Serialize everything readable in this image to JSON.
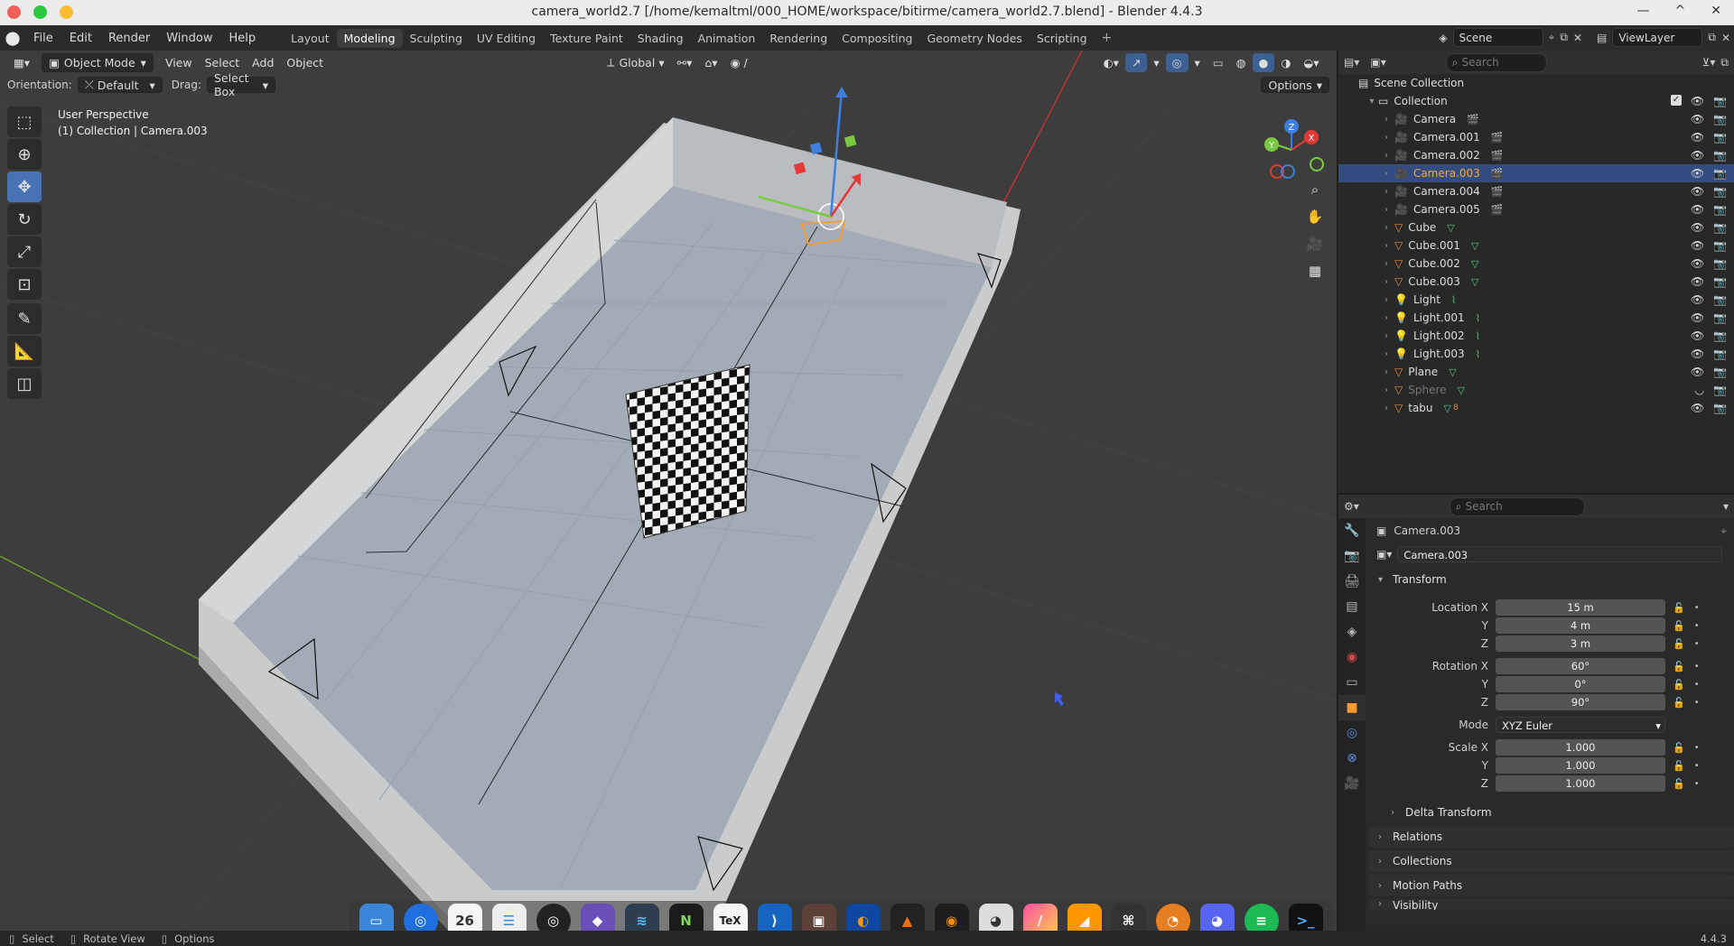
{
  "window": {
    "title": "camera_world2.7 [/home/kemaltml/000_HOME/workspace/bitirme/camera_world2.7.blend] - Blender 4.4.3",
    "buttons": [
      "—",
      "^",
      "✕"
    ]
  },
  "menubar": {
    "menus": [
      "File",
      "Edit",
      "Render",
      "Window",
      "Help"
    ],
    "workspaces": [
      "Layout",
      "Modeling",
      "Sculpting",
      "UV Editing",
      "Texture Paint",
      "Shading",
      "Animation",
      "Rendering",
      "Compositing",
      "Geometry Nodes",
      "Scripting"
    ],
    "active_workspace": "Modeling",
    "scene": "Scene",
    "view_layer": "ViewLayer"
  },
  "viewport": {
    "mode": "Object Mode",
    "menus": [
      "View",
      "Select",
      "Add",
      "Object"
    ],
    "transform_orientation": "Global",
    "orientation_label": "Orientation:",
    "orientation_value": "Default",
    "drag_label": "Drag:",
    "drag_value": "Select Box",
    "options": "Options",
    "perspective": "User Perspective",
    "context": "(1) Collection | Camera.003",
    "gizmo_labels": [
      "X",
      "Y",
      "Z"
    ]
  },
  "outliner": {
    "search_placeholder": "Search",
    "root": "Scene Collection",
    "collection": "Collection",
    "items": [
      {
        "name": "Camera",
        "type": "camera",
        "selected": false,
        "dim": false
      },
      {
        "name": "Camera.001",
        "type": "camera",
        "selected": false,
        "dim": false
      },
      {
        "name": "Camera.002",
        "type": "camera",
        "selected": false,
        "dim": false
      },
      {
        "name": "Camera.003",
        "type": "camera",
        "selected": true,
        "dim": false
      },
      {
        "name": "Camera.004",
        "type": "camera",
        "selected": false,
        "dim": false
      },
      {
        "name": "Camera.005",
        "type": "camera",
        "selected": false,
        "dim": false
      },
      {
        "name": "Cube",
        "type": "mesh",
        "selected": false,
        "dim": false
      },
      {
        "name": "Cube.001",
        "type": "mesh",
        "selected": false,
        "dim": false
      },
      {
        "name": "Cube.002",
        "type": "mesh",
        "selected": false,
        "dim": false
      },
      {
        "name": "Cube.003",
        "type": "mesh",
        "selected": false,
        "dim": false
      },
      {
        "name": "Light",
        "type": "light",
        "selected": false,
        "dim": false
      },
      {
        "name": "Light.001",
        "type": "light",
        "selected": false,
        "dim": false
      },
      {
        "name": "Light.002",
        "type": "light",
        "selected": false,
        "dim": false
      },
      {
        "name": "Light.003",
        "type": "light",
        "selected": false,
        "dim": false
      },
      {
        "name": "Plane",
        "type": "mesh",
        "selected": false,
        "dim": false
      },
      {
        "name": "Sphere",
        "type": "mesh",
        "selected": false,
        "dim": true
      },
      {
        "name": "tabu",
        "type": "mesh",
        "selected": false,
        "dim": false,
        "badge": "8"
      }
    ]
  },
  "properties": {
    "search_placeholder": "Search",
    "object_name": "Camera.003",
    "datablock": "Camera.003",
    "transform_label": "Transform",
    "location_label": "Location X",
    "location": [
      "15 m",
      "4 m",
      "3 m"
    ],
    "rotation_label": "Rotation X",
    "rotation": [
      "60°",
      "0°",
      "90°"
    ],
    "mode_label": "Mode",
    "mode": "XYZ Euler",
    "scale_label": "Scale X",
    "scale": [
      "1.000",
      "1.000",
      "1.000"
    ],
    "axis_y": "Y",
    "axis_z": "Z",
    "delta": "Delta Transform",
    "panels": [
      "Relations",
      "Collections",
      "Motion Paths",
      "Visibility"
    ]
  },
  "statusbar": {
    "items": [
      "Select",
      "Rotate View",
      "Options"
    ],
    "version": "4.4.3"
  },
  "dock": {
    "calendar_day": "26",
    "tex": "TeX"
  },
  "colors": {
    "accent": "#4772b3",
    "selection": "#334d80",
    "active_object": "#f59b2f",
    "viewport_bg": "#3d3d3d"
  }
}
